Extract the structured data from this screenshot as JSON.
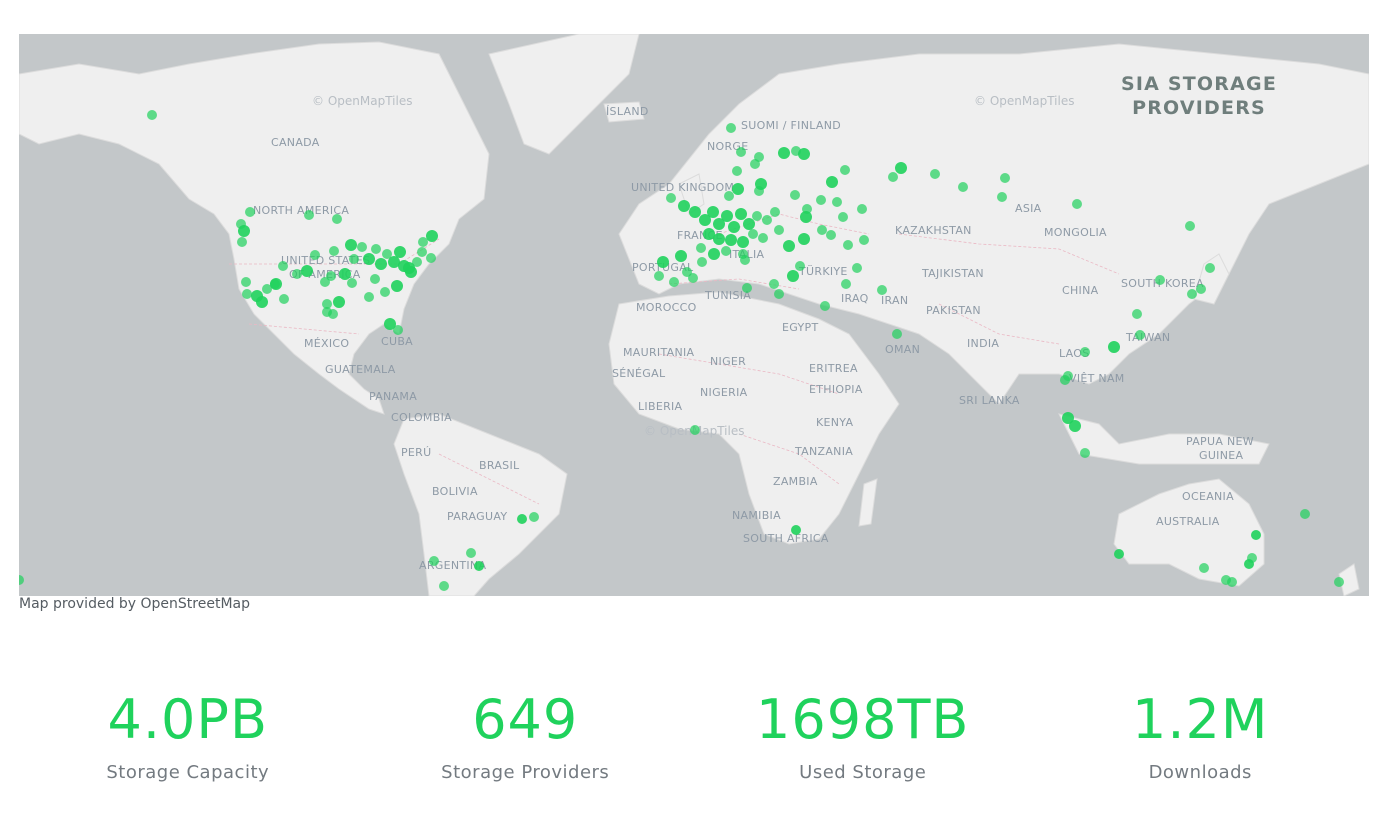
{
  "map": {
    "title_lines": [
      "SIA STORAGE",
      "PROVIDERS"
    ],
    "attribution_tiles": "© OpenMapTiles",
    "credit": "Map provided by OpenStreetMap",
    "labels": [
      "CANADA",
      "NORTH AMERICA",
      "UNITED STATES",
      "OF AMERICA",
      "MÉXICO",
      "CUBA",
      "GUATEMALA",
      "PANAMA",
      "COLOMBIA",
      "PERÚ",
      "BRASIL",
      "BOLIVIA",
      "PARAGUAY",
      "ARGENTINA",
      "ÍSLAND",
      "SUOMI / FINLAND",
      "NORGE",
      "UNITED KINGDOM",
      "FRANCE",
      "PORTUGAL",
      "ITALIA",
      "TÜRKIYE",
      "MOROCCO",
      "TUNISIA",
      "EGYPT",
      "MAURITANIA",
      "NIGER",
      "SÉNÉGAL",
      "NIGERIA",
      "LIBERIA",
      "ERITREA",
      "ETHIOPIA",
      "KENYA",
      "TANZANIA",
      "ZAMBIA",
      "NAMIBIA",
      "SOUTH AFRICA",
      "KAZAKHSTAN",
      "TAJIKISTAN",
      "IRAQ",
      "IRAN",
      "PAKISTAN",
      "OMAN",
      "INDIA",
      "SRI LANKA",
      "ASIA",
      "MONGOLIA",
      "CHINA",
      "SOUTH KOREA",
      "TAIWAN",
      "LAOS",
      "VIỆT NAM",
      "PAPUA NEW",
      "GUINEA",
      "OCEANIA",
      "AUSTRALIA"
    ],
    "marker_color": "#1fd25c"
  },
  "stats": [
    {
      "value": "4.0PB",
      "label": "Storage Capacity"
    },
    {
      "value": "649",
      "label": "Storage Providers"
    },
    {
      "value": "1698TB",
      "label": "Used Storage"
    },
    {
      "value": "1.2M",
      "label": "Downloads"
    }
  ]
}
